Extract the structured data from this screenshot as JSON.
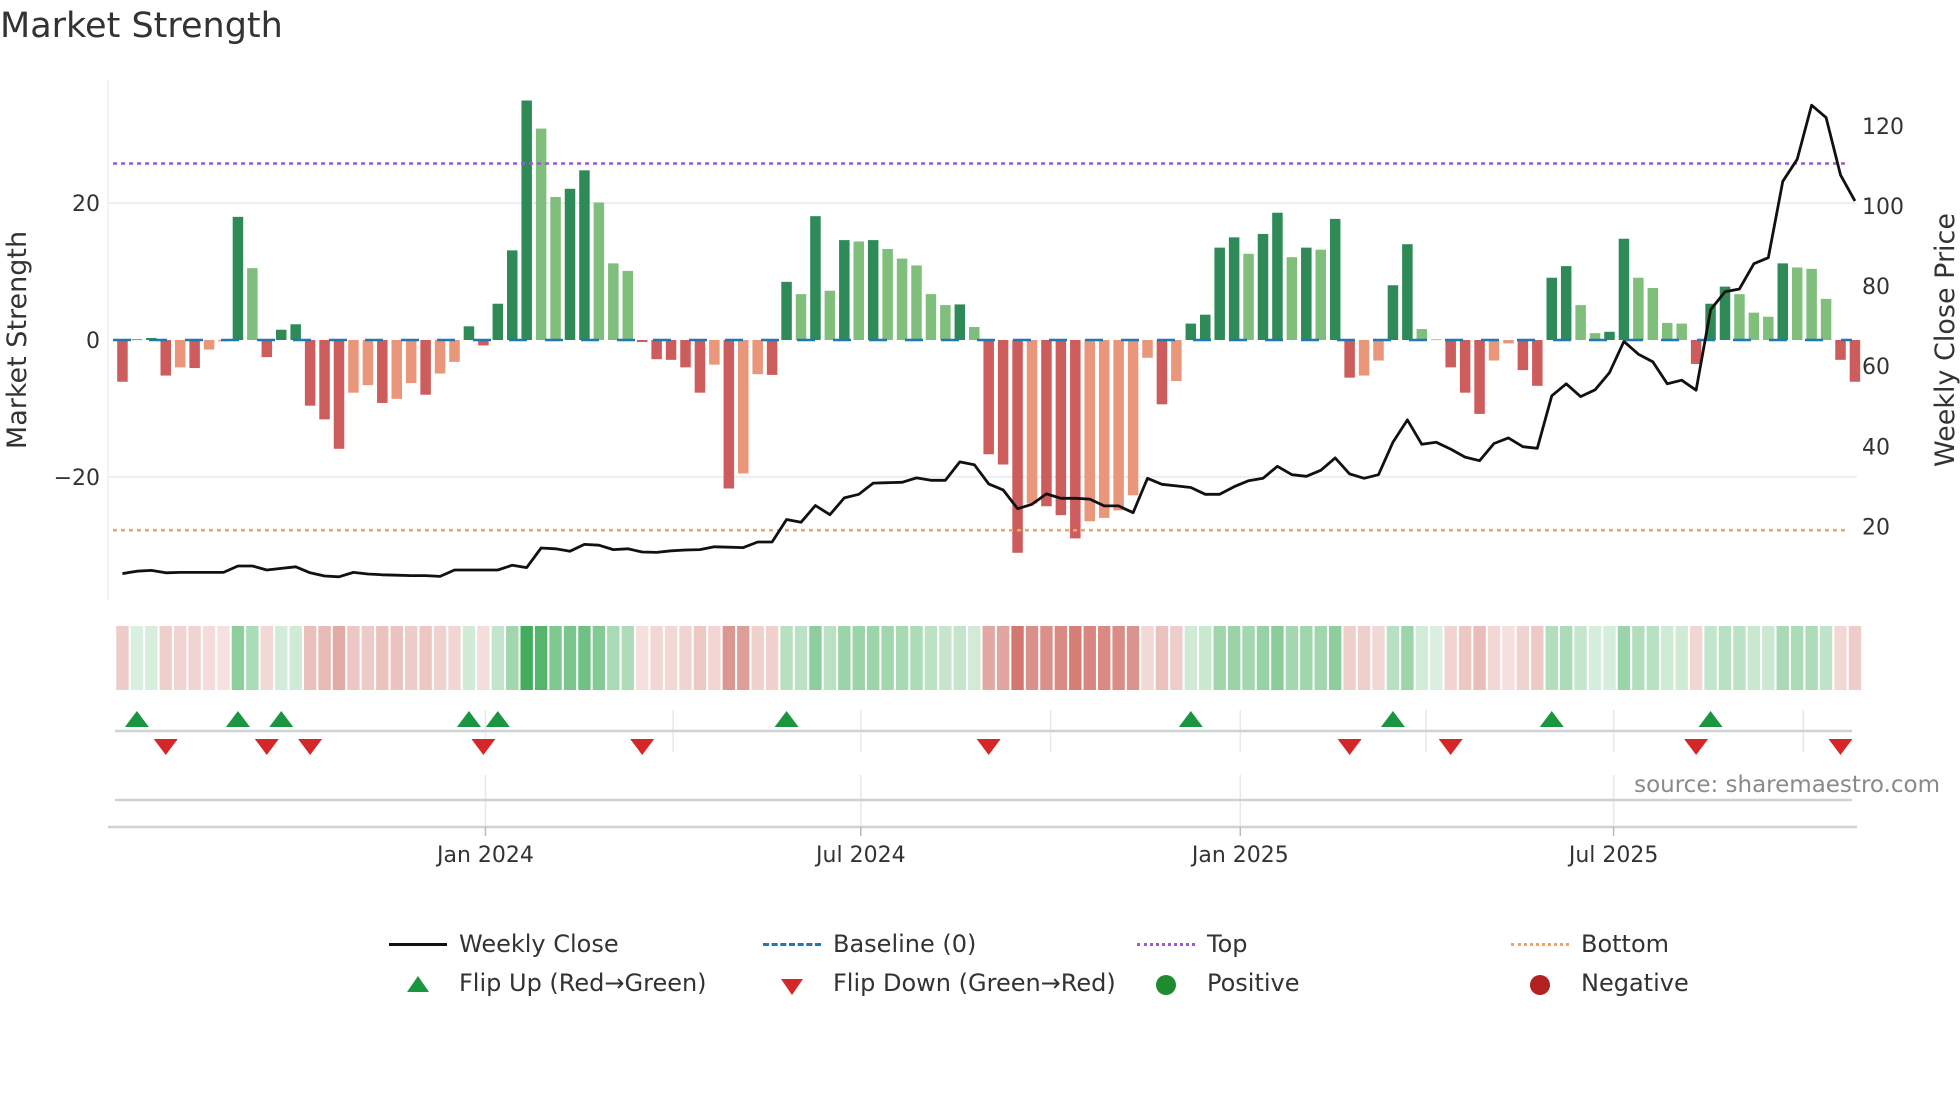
{
  "title": "Market Strength",
  "source": "source: sharemaestro.com",
  "legend": {
    "weekly_close": "Weekly Close",
    "baseline": "Baseline (0)",
    "top": "Top",
    "bottom": "Bottom",
    "flip_up": "Flip Up (Red→Green)",
    "flip_down": "Flip Down (Green→Red)",
    "positive": "Positive",
    "negative": "Negative"
  },
  "colors": {
    "green_rising": "#2e8b57",
    "green_falling": "#7fbf7b",
    "red_falling": "#cd5c5c",
    "red_rising": "#e9967a",
    "baseline": "#1f77b4",
    "top": "#9b59d6",
    "bottom": "#f4a460",
    "line": "#111111",
    "flip_up": "#1a9641",
    "flip_down": "#d62728",
    "positive": "#1e8c2e",
    "negative": "#b22222"
  },
  "chart_data": {
    "type": "bar",
    "title": "Market Strength",
    "ylabel": "Market Strength",
    "y2label": "Weekly Close Price",
    "ylim": [
      -38,
      38
    ],
    "y2lim": [
      1.6,
      131.5
    ],
    "yticks": [
      {
        "v": 20,
        "label": "20"
      },
      {
        "v": 0,
        "label": "0"
      },
      {
        "v": -20,
        "label": "−20"
      }
    ],
    "y2ticks": [
      {
        "v": 120,
        "label": "120"
      },
      {
        "v": 100,
        "label": "100"
      },
      {
        "v": 80,
        "label": "80"
      },
      {
        "v": 60,
        "label": "60"
      },
      {
        "v": 40,
        "label": "40"
      },
      {
        "v": 20,
        "label": "20"
      }
    ],
    "xticks": [
      {
        "date": "2024-01-01",
        "label": "Jan 2024"
      },
      {
        "date": "2024-07-01",
        "label": "Jul 2024"
      },
      {
        "date": "2025-01-01",
        "label": "Jan 2025"
      },
      {
        "date": "2025-07-01",
        "label": "Jul 2025"
      }
    ],
    "minor_x": [
      "2024-04-01",
      "2024-10-01",
      "2025-04-01",
      "2025-10-01"
    ],
    "xrange": [
      "2023-07-02",
      "2025-10-27"
    ],
    "start_week": "2023-07-09",
    "top_level": 25.8,
    "bottom_level": -27.8,
    "grid": true,
    "legend_position": "bottom",
    "strength": [
      -6.1,
      0.1,
      0.3,
      -5.2,
      -4.0,
      -4.1,
      -1.4,
      -0.2,
      18.0,
      10.5,
      -2.5,
      1.5,
      2.3,
      -9.6,
      -11.6,
      -15.9,
      -7.7,
      -6.6,
      -9.2,
      -8.6,
      -6.3,
      -8.0,
      -4.9,
      -3.2,
      2.0,
      -0.8,
      5.3,
      13.1,
      35.0,
      30.9,
      20.9,
      22.1,
      24.8,
      20.1,
      11.2,
      10.1,
      -0.3,
      -2.8,
      -2.9,
      -4.0,
      -7.7,
      -3.6,
      -21.7,
      -19.5,
      -5.0,
      -5.1,
      8.5,
      6.7,
      18.1,
      7.2,
      14.6,
      14.4,
      14.6,
      13.3,
      11.9,
      10.9,
      6.7,
      5.1,
      5.2,
      1.9,
      -16.7,
      -18.2,
      -31.1,
      -23.9,
      -24.3,
      -25.6,
      -29.0,
      -26.5,
      -26.0,
      -24.9,
      -22.7,
      -2.6,
      -9.4,
      -6.0,
      2.4,
      3.7,
      13.5,
      15.0,
      12.6,
      15.5,
      18.6,
      12.1,
      13.5,
      13.2,
      17.7,
      -5.5,
      -5.2,
      -3.0,
      8.0,
      14.0,
      1.6,
      0.1,
      -4.0,
      -7.7,
      -10.8,
      -3.0,
      -0.5,
      -4.4,
      -6.7,
      9.1,
      10.8,
      5.1,
      1.0,
      1.2,
      14.8,
      9.1,
      7.6,
      2.5,
      2.4,
      -3.5,
      5.3,
      7.8,
      6.7,
      4.0,
      3.4,
      11.2,
      10.6,
      10.4,
      6.0,
      -2.9,
      -6.1
    ],
    "weekly_close": [
      8.2,
      8.8,
      9.0,
      8.4,
      8.5,
      8.5,
      8.5,
      8.5,
      10.1,
      10.1,
      9.1,
      9.5,
      9.9,
      8.4,
      7.6,
      7.4,
      8.5,
      8.1,
      7.9,
      7.8,
      7.7,
      7.7,
      7.5,
      9.1,
      9.1,
      9.1,
      9.1,
      10.3,
      9.7,
      14.6,
      14.4,
      13.8,
      15.5,
      15.3,
      14.2,
      14.4,
      13.6,
      13.5,
      13.9,
      14.1,
      14.2,
      14.9,
      14.8,
      14.7,
      16.1,
      16.1,
      21.7,
      21.0,
      25.2,
      22.9,
      27.1,
      28.0,
      30.8,
      30.9,
      31.0,
      32.1,
      31.5,
      31.5,
      36.1,
      35.4,
      30.6,
      29.1,
      24.4,
      25.5,
      28.1,
      27.0,
      27.0,
      26.8,
      25.1,
      25.1,
      23.4,
      32.0,
      30.5,
      30.1,
      29.7,
      28.0,
      28.0,
      29.9,
      31.4,
      32.0,
      35.0,
      32.9,
      32.5,
      34.0,
      37.1,
      33.1,
      32.0,
      32.9,
      41.0,
      46.6,
      40.5,
      41.0,
      39.3,
      37.3,
      36.4,
      40.7,
      42.1,
      39.9,
      39.5,
      52.6,
      55.6,
      52.4,
      54.1,
      58.4,
      66.2,
      63.0,
      61.1,
      55.6,
      56.5,
      54.0,
      74.1,
      78.6,
      79.3,
      85.6,
      87.1,
      106.2,
      111.7,
      125.2,
      122.1,
      107.8,
      101.3
    ]
  }
}
